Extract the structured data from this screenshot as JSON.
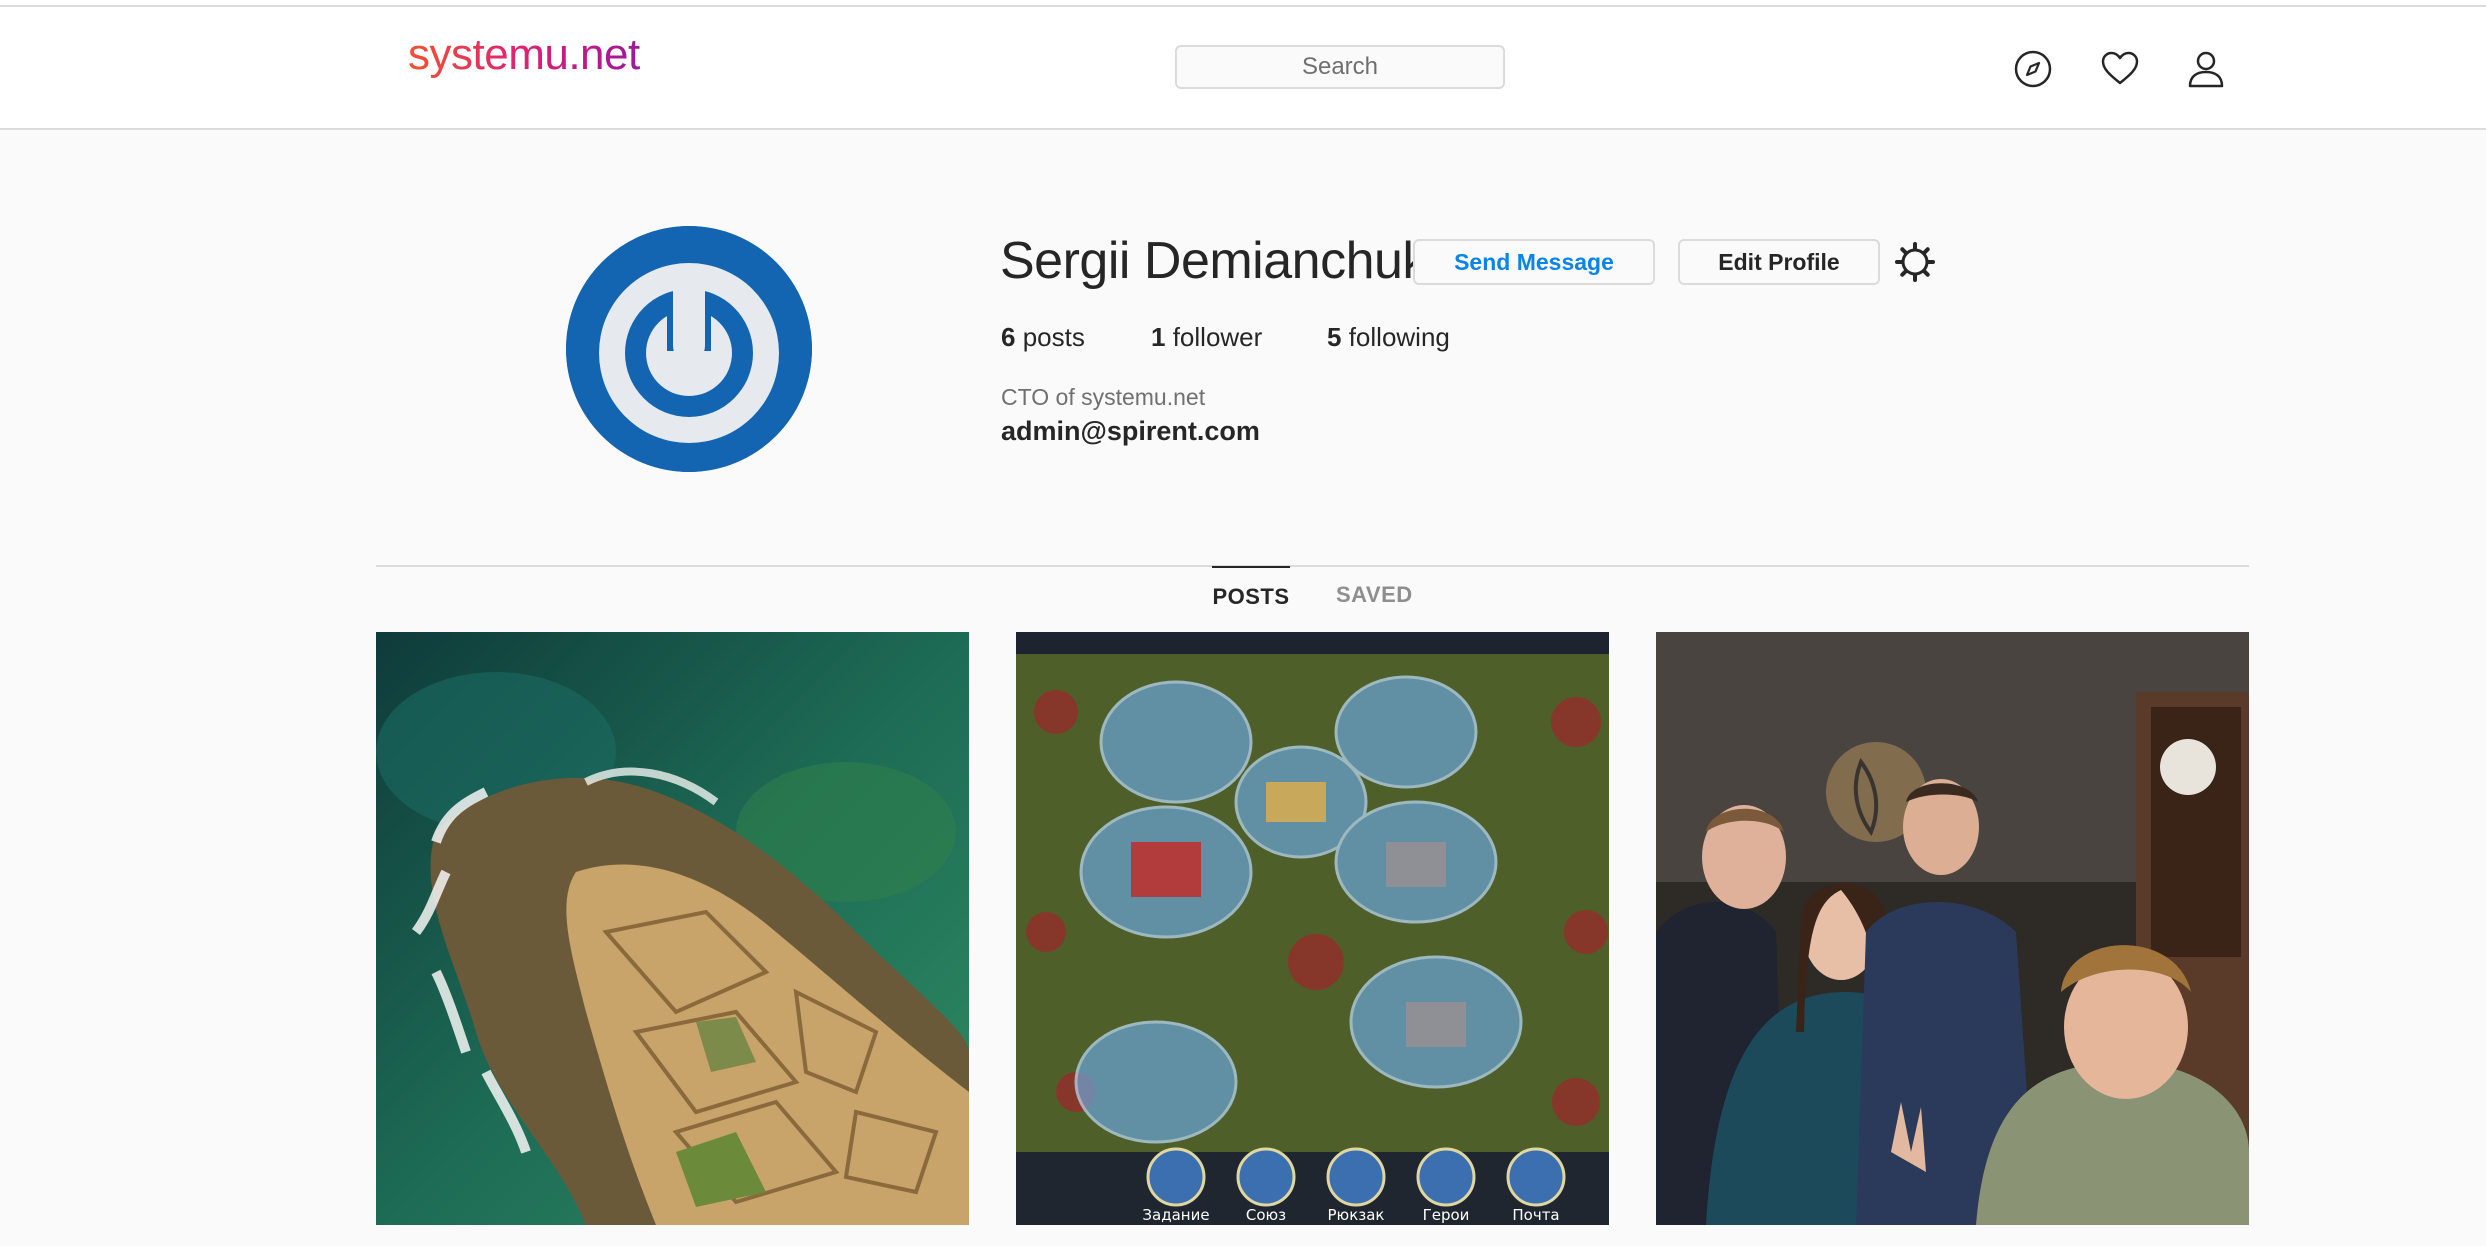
{
  "header": {
    "logo_text": "systemu.net",
    "search_placeholder": "Search",
    "icons": [
      "compass-icon",
      "heart-icon",
      "user-icon"
    ]
  },
  "profile": {
    "username": "Sergii Demianchuk",
    "send_message_label": "Send Message",
    "edit_profile_label": "Edit Profile",
    "stats": {
      "posts_count": "6",
      "posts_label": "posts",
      "followers_count": "1",
      "followers_label": "follower",
      "following_count": "5",
      "following_label": "following"
    },
    "bio": "CTO of systemu.net",
    "email": "admin@spirent.com"
  },
  "tabs": [
    {
      "label": "POSTS",
      "active": true
    },
    {
      "label": "SAVED",
      "active": false
    }
  ],
  "posts": [
    {
      "subject": "aerial view of coastline salt pans"
    },
    {
      "subject": "strategy game screenshot"
    },
    {
      "subject": "group selfie of four people"
    }
  ],
  "game_bottom_labels": [
    "Задание",
    "Союз",
    "Рюкзак",
    "Герои",
    "Почта"
  ],
  "colors": {
    "accent": "#0a84e6",
    "avatar_bg": "#1365b2",
    "border": "#dbdbdb",
    "background": "#fafafa"
  }
}
